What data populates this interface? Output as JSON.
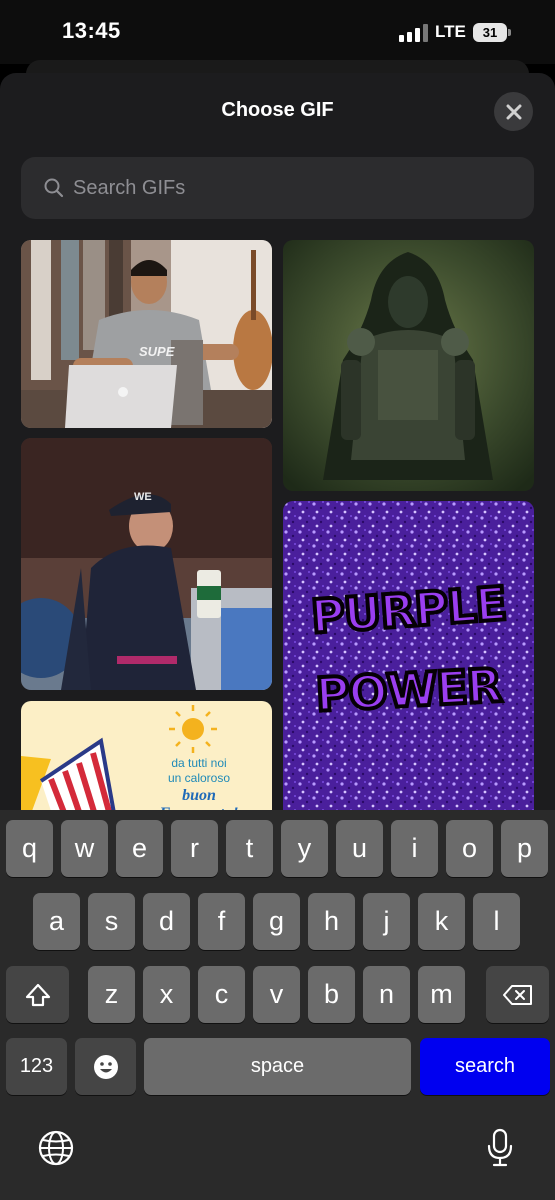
{
  "status_bar": {
    "time": "13:45",
    "carrier": "LTE",
    "battery": "31"
  },
  "modal": {
    "title": "Choose GIF"
  },
  "search": {
    "placeholder": "Search GIFs"
  },
  "gifs": {
    "laptop_text": "SUPE",
    "cap_text": "WE",
    "purple_line1": "PURPLE",
    "purple_line2": "POWER",
    "ferragosto_line1": "da tutti noi",
    "ferragosto_line2": "un caloroso",
    "ferragosto_line3": "buon",
    "ferragosto_line4": "Ferragosto!"
  },
  "keyboard": {
    "row1": [
      "q",
      "w",
      "e",
      "r",
      "t",
      "y",
      "u",
      "i",
      "o",
      "p"
    ],
    "row2": [
      "a",
      "s",
      "d",
      "f",
      "g",
      "h",
      "j",
      "k",
      "l"
    ],
    "row3": [
      "z",
      "x",
      "c",
      "v",
      "b",
      "n",
      "m"
    ],
    "numbers_label": "123",
    "space_label": "space",
    "search_label": "search"
  },
  "colors": {
    "search_key": "#0000f0",
    "background": "#1c1c1e"
  },
  "icons": [
    "search-icon",
    "close-icon",
    "shift-icon",
    "delete-icon",
    "emoji-icon",
    "globe-icon",
    "microphone-icon"
  ]
}
